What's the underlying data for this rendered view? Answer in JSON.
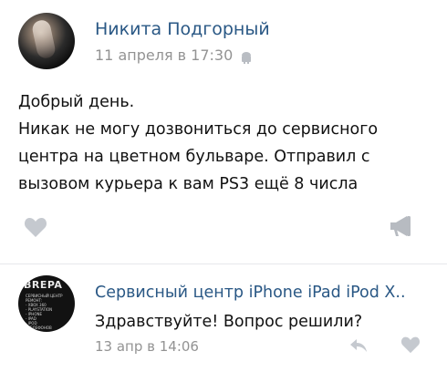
{
  "post": {
    "author": "Никита Подгорный",
    "date": "11 апреля в 17:30",
    "text_lines": [
      "Добрый день.",
      "Никак не могу дозвониться до сервисного",
      "центра на цветном бульваре. Отправил с",
      "вызовом курьера к вам PS3 ещё 8 числа"
    ],
    "icons": {
      "device": "android-icon",
      "like": "heart-icon",
      "share": "megaphone-icon"
    }
  },
  "reply": {
    "author": "Сервисный центр iPhone iPad iPod X..",
    "text": "Здравствуйте! Вопрос решили?",
    "date": "13 апр в 14:06",
    "avatar": {
      "brand": "BREPA",
      "lines": [
        "СЕРВИСНЫЙ ЦЕНТР",
        "РЕМОНТ:",
        "- XBOX 360",
        "- PLAYSTATION",
        "- IPHONE",
        "- IPAD",
        "- IPOD",
        "- ТЕЛЕФОНОВ"
      ]
    },
    "icons": {
      "reply": "reply-arrow-icon",
      "like": "heart-icon"
    }
  },
  "colors": {
    "link": "#2a5885",
    "meta": "#939393",
    "icon": "#c5c9cf",
    "divider": "#e7e8ec"
  }
}
